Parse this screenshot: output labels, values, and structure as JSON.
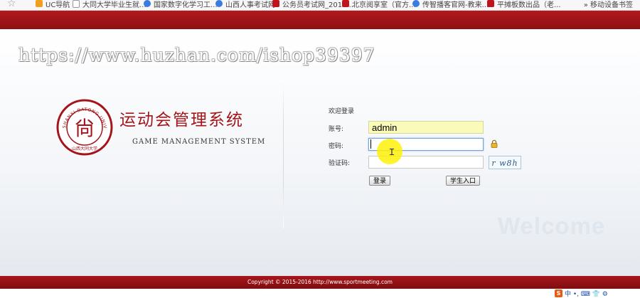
{
  "bookmarks": [
    {
      "label": "UC导航",
      "icon": "uc-icon"
    },
    {
      "label": "大同大学毕业生就...",
      "icon": "page-icon"
    },
    {
      "label": "国家数字化学习工...",
      "icon": "globe-icon"
    },
    {
      "label": "山西人事考试网",
      "icon": "globe-icon"
    },
    {
      "label": "公务员考试网_2015...",
      "icon": "red-site-icon"
    },
    {
      "label": "北京阅享室（官方...",
      "icon": "red-site-icon"
    },
    {
      "label": "传智播客官网-教来...",
      "icon": "globe-icon"
    },
    {
      "label": "平摊板数出品（老...",
      "icon": "red-site-icon"
    }
  ],
  "bookmarks_more": "» 移动设备书签",
  "watermark": "https://www.huzhan.com/ishop39397",
  "logo": {
    "ring_text": "SHANXI DATONG UNIVERSITY",
    "bottom_text": "山西大同大学",
    "center_glyph": "尙"
  },
  "system": {
    "title": "运动会管理系统",
    "subtitle": "GAME MANAGEMENT SYSTEM"
  },
  "form": {
    "title": "欢迎登录",
    "username_label": "账号:",
    "username_value": "admin",
    "password_label": "密码:",
    "password_value": "",
    "captcha_label": "验证码:",
    "captcha_value": "",
    "captcha_image_text": "r w8h",
    "login_button": "登录",
    "student_button": "学生入口"
  },
  "welcome_text": "Welcome",
  "footer": "Copyright © 2015-2016 http://www.sportmeeting.com",
  "tray": {
    "ime_logo": "S",
    "ime_text": "中 •, ⌨ 👕 ⚙"
  },
  "colors": {
    "brand_red": "#a3151b",
    "header_red": "#b01a1e",
    "autofill": "#fbfbb9",
    "focus_blue": "#6fa2df"
  }
}
